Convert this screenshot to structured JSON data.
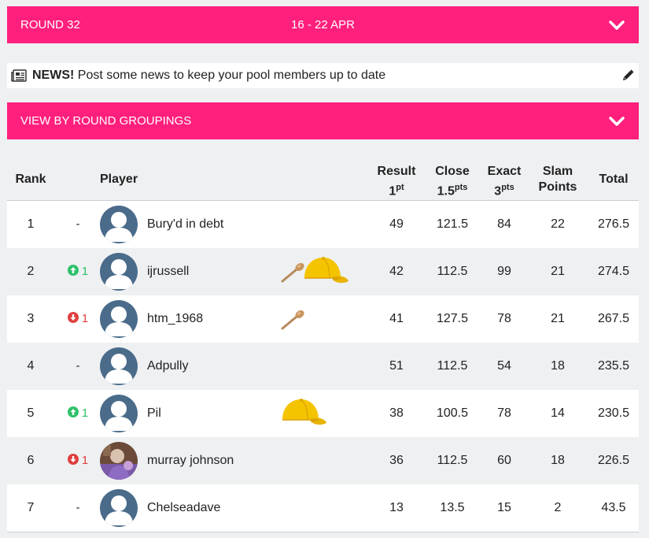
{
  "round": {
    "label": "ROUND 32",
    "dates": "16 - 22 APR"
  },
  "news": {
    "strong": "NEWS!",
    "text": " Post some news to keep your pool members up to date"
  },
  "groupings": {
    "label": "VIEW BY ROUND GROUPINGS"
  },
  "colors": {
    "brand": "#ff1f7c",
    "up": "#2fc16a",
    "down": "#e04040",
    "avatar_bg": "#4a6b8a"
  },
  "headers": {
    "rank": "Rank",
    "player": "Player",
    "result": {
      "line1": "Result",
      "line2": "1",
      "sup": "pt"
    },
    "close": {
      "line1": "Close",
      "line2": "1.5",
      "sup": "pts"
    },
    "exact": {
      "line1": "Exact",
      "line2": "3",
      "sup": "pts"
    },
    "slam": {
      "line1": "Slam",
      "line2": "Points"
    },
    "total": "Total"
  },
  "rows": [
    {
      "rank": "1",
      "move": "-",
      "move_dir": "none",
      "player": "Bury'd in debt",
      "avatar": "default-avatar-icon",
      "awards": [],
      "result": "49",
      "close": "121.5",
      "exact": "84",
      "slam": "22",
      "total": "276.5"
    },
    {
      "rank": "2",
      "move": "1",
      "move_dir": "up",
      "player": "ijrussell",
      "avatar": "default-avatar-icon",
      "awards": [
        "wooden-spoon-icon",
        "yellow-cap-icon"
      ],
      "result": "42",
      "close": "112.5",
      "exact": "99",
      "slam": "21",
      "total": "274.5"
    },
    {
      "rank": "3",
      "move": "1",
      "move_dir": "down",
      "player": "htm_1968",
      "avatar": "default-avatar-icon",
      "awards": [
        "wooden-spoon-icon"
      ],
      "result": "41",
      "close": "127.5",
      "exact": "78",
      "slam": "21",
      "total": "267.5"
    },
    {
      "rank": "4",
      "move": "-",
      "move_dir": "none",
      "player": "Adpully",
      "avatar": "default-avatar-icon",
      "awards": [],
      "result": "51",
      "close": "112.5",
      "exact": "54",
      "slam": "18",
      "total": "235.5"
    },
    {
      "rank": "5",
      "move": "1",
      "move_dir": "up",
      "player": "Pil",
      "avatar": "default-avatar-icon",
      "awards": [
        "yellow-cap-icon"
      ],
      "result": "38",
      "close": "100.5",
      "exact": "78",
      "slam": "14",
      "total": "230.5"
    },
    {
      "rank": "6",
      "move": "1",
      "move_dir": "down",
      "player": "murray johnson",
      "avatar": "photo-avatar",
      "awards": [],
      "result": "36",
      "close": "112.5",
      "exact": "60",
      "slam": "18",
      "total": "226.5"
    },
    {
      "rank": "7",
      "move": "-",
      "move_dir": "none",
      "player": "Chelseadave",
      "avatar": "default-avatar-icon",
      "awards": [],
      "result": "13",
      "close": "13.5",
      "exact": "15",
      "slam": "2",
      "total": "43.5"
    }
  ]
}
